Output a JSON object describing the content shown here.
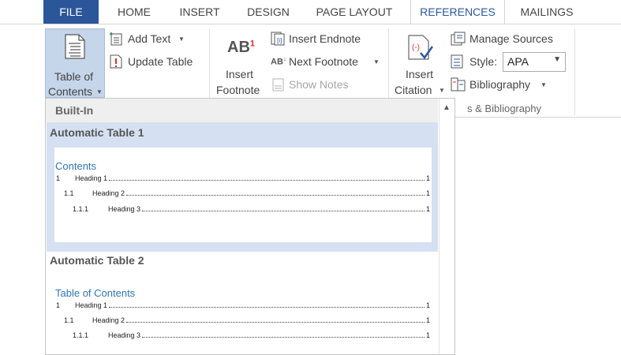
{
  "tabs": [
    {
      "label": "FILE"
    },
    {
      "label": "HOME"
    },
    {
      "label": "INSERT"
    },
    {
      "label": "DESIGN"
    },
    {
      "label": "PAGE LAYOUT"
    },
    {
      "label": "REFERENCES"
    },
    {
      "label": "MAILINGS"
    }
  ],
  "ribbon": {
    "toc": {
      "label1": "Table of",
      "label2": "Contents"
    },
    "add_text": "Add Text",
    "update_table": "Update Table",
    "insert_footnote": {
      "label1": "Insert",
      "label2": "Footnote",
      "icon_text": "AB",
      "sup": "1"
    },
    "insert_endnote": "Insert Endnote",
    "next_footnote": "Next Footnote",
    "show_notes": "Show Notes",
    "insert_citation": {
      "label1": "Insert",
      "label2": "Citation"
    },
    "manage_sources": "Manage Sources",
    "style_label": "Style:",
    "style_value": "APA",
    "bibliography": "Bibliography",
    "group_label": "s & Bibliography"
  },
  "dropdown": {
    "header": "Built-In",
    "gallery": [
      {
        "title": "Automatic Table 1",
        "heading": "Contents",
        "entries": [
          {
            "num": "1",
            "text": "Heading 1",
            "page": "1"
          },
          {
            "num": "1.1",
            "text": "Heading 2",
            "page": "1"
          },
          {
            "num": "1.1.1",
            "text": "Heading 3",
            "page": "1"
          }
        ]
      },
      {
        "title": "Automatic Table 2",
        "heading": "Table of Contents",
        "entries": [
          {
            "num": "1",
            "text": "Heading 1",
            "page": "1"
          },
          {
            "num": "1.1",
            "text": "Heading 2",
            "page": "1"
          },
          {
            "num": "1.1.1",
            "text": "Heading 3",
            "page": "1"
          }
        ]
      }
    ]
  },
  "colors": {
    "accent": "#2b579a",
    "selected_bg": "#d5e1f2",
    "toc_heading": "#2e74b5"
  }
}
